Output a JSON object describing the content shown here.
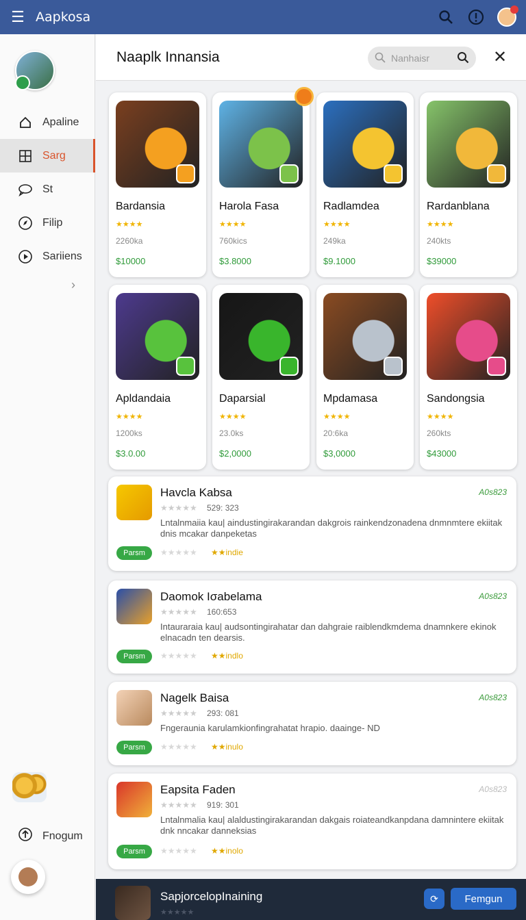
{
  "topbar": {
    "title": "Aapkosa",
    "icons": [
      "menu-icon",
      "search-icon",
      "info-icon",
      "avatar"
    ]
  },
  "sidebar": {
    "items": [
      {
        "label": "Apaline",
        "icon": "home-icon"
      },
      {
        "label": "Sarg",
        "icon": "grid-icon",
        "active": true
      },
      {
        "label": "St",
        "icon": "chat-icon"
      },
      {
        "label": "Filip",
        "icon": "compass-icon"
      },
      {
        "label": "Sariiens",
        "icon": "play-icon"
      }
    ],
    "bottom_label": "Fnogum"
  },
  "header": {
    "title": "Naaplk Innansia",
    "search_placeholder": "Nanhaisr"
  },
  "apps": [
    {
      "name": "Bardansia",
      "stars": "★★★★",
      "size": "2260ka",
      "price": "$10000",
      "bg": "#7a3f1f",
      "accent": "#f4a020"
    },
    {
      "name": "Harola Fasa",
      "stars": "★★★★",
      "size": "760kics",
      "price": "$3.8000",
      "bg": "#5fb3e6",
      "accent": "#7cc24a"
    },
    {
      "name": "Radlamdea",
      "stars": "★★★★",
      "size": "249ka",
      "price": "$9.1000",
      "bg": "#2b6fbf",
      "accent": "#f4c430"
    },
    {
      "name": "Rardanblana",
      "stars": "★★★★",
      "size": "240kts",
      "price": "$39000",
      "bg": "#86c46a",
      "accent": "#f1b83a"
    },
    {
      "name": "Apldandaia",
      "stars": "★★★★",
      "size": "1200ks",
      "price": "$3.0.00",
      "bg": "#4d3a8e",
      "accent": "#58c23d"
    },
    {
      "name": "Daparsial",
      "stars": "★★★★",
      "size": "23.0ks",
      "price": "$2,0000",
      "bg": "#161616",
      "accent": "#39b52c"
    },
    {
      "name": "Mpdamasa",
      "stars": "★★★★",
      "size": "20:6ka",
      "price": "$3,0000",
      "bg": "#8a4b22",
      "accent": "#b9c2cc"
    },
    {
      "name": "Sandongsia",
      "stars": "★★★★",
      "size": "260kts",
      "price": "$43000",
      "bg": "#ef4e2a",
      "accent": "#e64c8a"
    }
  ],
  "rows": [
    {
      "name": "Havcla Kabsa",
      "date": "A0s823",
      "count": "529: 323",
      "desc": "Lntalnmaiia kau| aindustingirakarandan dakgrois rainkendzonadena dnmnmtere ekiitak dnis mcakar danpeketas",
      "btn": "Parsm",
      "tag": "★★indie"
    },
    {
      "name": "Daomok Iσabelama",
      "date": "A0s823",
      "count": "160:653",
      "desc": "Intauraraia kau| audsontingirahatar dan dahgraie raiblendkmdema dnamnkere ekinok elnacadn ten dearsis.",
      "btn": "Parsm",
      "tag": "★★indlo"
    },
    {
      "name": "Nagelk Baisa",
      "date": "A0s823",
      "count": "293: 081",
      "desc": "Fngeraunia karulamkionfingrahatat hrapio. daainge- ND",
      "btn": "Parsm",
      "tag": "★★inulo"
    },
    {
      "name": "Eapsita Faden",
      "date": "A0s823",
      "count": "919: 301",
      "desc": "Lntalnmalia kau| alaldustingirakarandan dakgais roiateandkanpdana damnintere ekiitak dnk nncakar danneksias",
      "btn": "Parsm",
      "tag": "★★inolo"
    }
  ],
  "bottom_bar": {
    "title": "SapjorcelopInaining",
    "stars": "★★★★★",
    "button": "Femgun"
  }
}
